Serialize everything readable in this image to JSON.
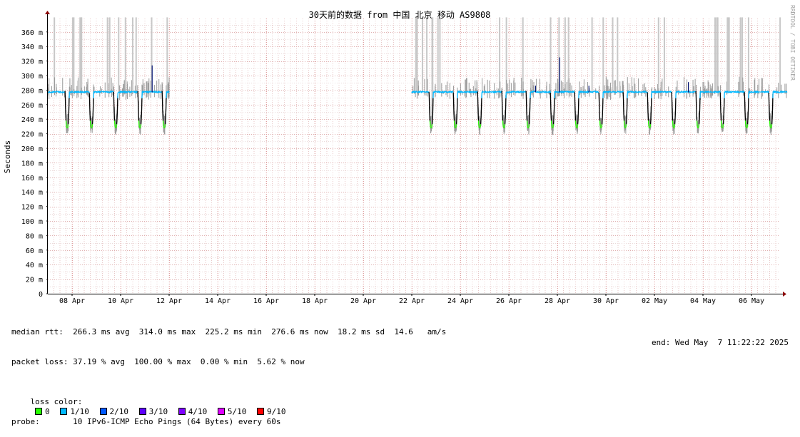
{
  "chart_data": {
    "type": "line",
    "title": "30天前的数据 from 中国 北京 移动 AS9808",
    "ylabel": "Seconds",
    "watermark": "RRDTOOL / TOBI OETIKER",
    "ylim": [
      0,
      380
    ],
    "y_ticks": [
      "0",
      "20 m",
      "40 m",
      "60 m",
      "80 m",
      "100 m",
      "120 m",
      "140 m",
      "160 m",
      "180 m",
      "200 m",
      "220 m",
      "240 m",
      "260 m",
      "280 m",
      "300 m",
      "320 m",
      "340 m",
      "360 m"
    ],
    "x_ticks": [
      "08 Apr",
      "10 Apr",
      "12 Apr",
      "14 Apr",
      "16 Apr",
      "18 Apr",
      "20 Apr",
      "22 Apr",
      "24 Apr",
      "26 Apr",
      "28 Apr",
      "30 Apr",
      "02 May",
      "04 May",
      "06 May"
    ],
    "x_range_days_from_apr7": [
      0,
      30.47
    ],
    "segments": [
      {
        "start": 7.0,
        "end": 12.0
      },
      {
        "start": 22.0,
        "end": 37.47
      }
    ],
    "daily_pattern_ms": {
      "plateau": 277,
      "dip": 228
    },
    "peaks_ms": [
      [
        11.3,
        314
      ],
      [
        27.1,
        286
      ],
      [
        28.1,
        325
      ],
      [
        29.3,
        286
      ],
      [
        33.4,
        291
      ]
    ],
    "grid": true,
    "legend": "bottom"
  },
  "stats": {
    "median_rtt": "median rtt:  266.3 ms avg  314.0 ms max  225.2 ms min  276.6 ms now  18.2 ms sd  14.6   am/s",
    "packet_loss": "packet loss: 37.19 % avg  100.00 % max  0.00 % min  5.62 % now",
    "loss_color_label": "loss color:",
    "loss_colors": [
      {
        "label": "0",
        "color": "#26ff00"
      },
      {
        "label": "1/10",
        "color": "#00b8ff"
      },
      {
        "label": "2/10",
        "color": "#0059ff"
      },
      {
        "label": "3/10",
        "color": "#5e00ff"
      },
      {
        "label": "4/10",
        "color": "#7e00ff"
      },
      {
        "label": "5/10",
        "color": "#dd00ff"
      },
      {
        "label": "9/10",
        "color": "#ff0000"
      }
    ],
    "probe": "probe:       10 IPv6-ICMP Echo Pings (64 Bytes) every 60s",
    "end": "end: Wed May  7 11:22:22 2025"
  }
}
